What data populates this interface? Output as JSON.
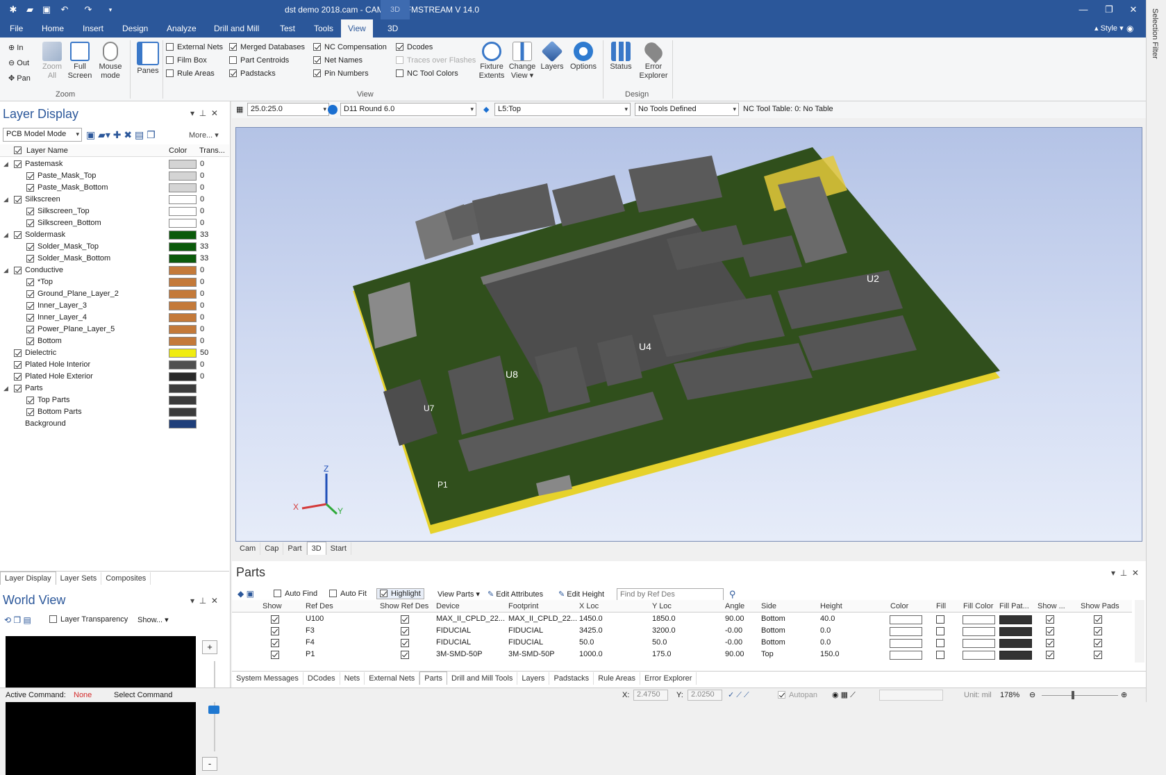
{
  "title_bar": {
    "title": "dst demo 2018.cam - CAM350/DFMSTREAM V 14.0",
    "context_tab": "3D"
  },
  "menu": {
    "items": [
      "File",
      "Home",
      "Insert",
      "Design",
      "Analyze",
      "Drill and Mill",
      "Test",
      "Tools",
      "View",
      "3D"
    ],
    "active": "View",
    "style_label": "Style"
  },
  "ribbon": {
    "zoom": {
      "in": "In",
      "out": "Out",
      "pan": "Pan",
      "zoom_all": "Zoom All",
      "full_screen": "Full Screen",
      "mouse_mode": "Mouse mode",
      "label": "Zoom"
    },
    "panes": "Panes",
    "view_checks": [
      {
        "label": "External Nets",
        "checked": false,
        "disabled": false
      },
      {
        "label": "Film Box",
        "checked": false,
        "disabled": false
      },
      {
        "label": "Rule Areas",
        "checked": false,
        "disabled": false
      },
      {
        "label": "Merged Databases",
        "checked": true,
        "disabled": false
      },
      {
        "label": "Part Centroids",
        "checked": false,
        "disabled": false
      },
      {
        "label": "Padstacks",
        "checked": true,
        "disabled": false
      },
      {
        "label": "NC Compensation",
        "checked": true,
        "disabled": false
      },
      {
        "label": "Net Names",
        "checked": true,
        "disabled": false
      },
      {
        "label": "Pin Numbers",
        "checked": true,
        "disabled": false
      },
      {
        "label": "Dcodes",
        "checked": true,
        "disabled": false
      },
      {
        "label": "Traces over Flashes",
        "checked": false,
        "disabled": true
      },
      {
        "label": "NC Tool Colors",
        "checked": false,
        "disabled": false
      }
    ],
    "fixture_extents": "Fixture Extents",
    "change_view": "Change View",
    "layers": "Layers",
    "options": "Options",
    "view_label": "View",
    "status": "Status",
    "error_explorer": "Error Explorer",
    "design_label": "Design"
  },
  "layer_display": {
    "title": "Layer Display",
    "mode": "PCB Model Mode",
    "more": "More...",
    "col_name": "Layer Name",
    "col_color": "Color",
    "col_trans": "Trans...",
    "rows": [
      {
        "name": "Pastemask",
        "level": 0,
        "color": "#d4d4d4",
        "trans": "0",
        "checkbox": true
      },
      {
        "name": "Paste_Mask_Top",
        "level": 1,
        "color": "#d4d4d4",
        "trans": "0",
        "checkbox": true
      },
      {
        "name": "Paste_Mask_Bottom",
        "level": 1,
        "color": "#d4d4d4",
        "trans": "0",
        "checkbox": true
      },
      {
        "name": "Silkscreen",
        "level": 0,
        "color": "#ffffff",
        "trans": "0",
        "checkbox": true
      },
      {
        "name": "Silkscreen_Top",
        "level": 1,
        "color": "#ffffff",
        "trans": "0",
        "checkbox": true
      },
      {
        "name": "Silkscreen_Bottom",
        "level": 1,
        "color": "#ffffff",
        "trans": "0",
        "checkbox": true
      },
      {
        "name": "Soldermask",
        "level": 0,
        "color": "#0b5a0b",
        "trans": "33",
        "checkbox": true
      },
      {
        "name": "Solder_Mask_Top",
        "level": 1,
        "color": "#0b5a0b",
        "trans": "33",
        "checkbox": true
      },
      {
        "name": "Solder_Mask_Bottom",
        "level": 1,
        "color": "#0b5a0b",
        "trans": "33",
        "checkbox": true
      },
      {
        "name": "Conductive",
        "level": 0,
        "color": "#c47a3a",
        "trans": "0",
        "checkbox": true
      },
      {
        "name": "*Top",
        "level": 1,
        "color": "#c47a3a",
        "trans": "0",
        "checkbox": true
      },
      {
        "name": "Ground_Plane_Layer_2",
        "level": 1,
        "color": "#c47a3a",
        "trans": "0",
        "checkbox": true
      },
      {
        "name": "Inner_Layer_3",
        "level": 1,
        "color": "#c47a3a",
        "trans": "0",
        "checkbox": true
      },
      {
        "name": "Inner_Layer_4",
        "level": 1,
        "color": "#c47a3a",
        "trans": "0",
        "checkbox": true
      },
      {
        "name": "Power_Plane_Layer_5",
        "level": 1,
        "color": "#c47a3a",
        "trans": "0",
        "checkbox": true
      },
      {
        "name": "Bottom",
        "level": 1,
        "color": "#c47a3a",
        "trans": "0",
        "checkbox": true
      },
      {
        "name": "Dielectric",
        "level": 0,
        "color": "#f0ec10",
        "trans": "50",
        "checkbox": true
      },
      {
        "name": "Plated Hole Interior",
        "level": 0,
        "color": "#505050",
        "trans": "0",
        "checkbox": true
      },
      {
        "name": "Plated Hole Exterior",
        "level": 0,
        "color": "#2a2a2a",
        "trans": "0",
        "checkbox": true
      },
      {
        "name": "Parts",
        "level": 0,
        "color": "#3c3c3c",
        "trans": "",
        "checkbox": true
      },
      {
        "name": "Top Parts",
        "level": 1,
        "color": "#3c3c3c",
        "trans": "",
        "checkbox": true
      },
      {
        "name": "Bottom Parts",
        "level": 1,
        "color": "#3c3c3c",
        "trans": "",
        "checkbox": true
      },
      {
        "name": "Background",
        "level": 0,
        "color": "#1f3f7a",
        "trans": "",
        "checkbox": false
      }
    ],
    "tabs": [
      "Layer Display",
      "Layer Sets",
      "Composites"
    ]
  },
  "world_view": {
    "title": "World View",
    "layer_transparency": "Layer Transparency",
    "show": "Show...",
    "plus": "+",
    "minus": "-"
  },
  "viewbar": {
    "zoom_value": "25.0:25.0",
    "dcode": "D11   Round 6.0",
    "layer": "L5:Top",
    "tools": "No Tools Defined",
    "nc_table": "NC Tool Table: 0: No Table"
  },
  "viewport": {
    "axis": {
      "z": "Z",
      "x": "X",
      "y": "Y"
    },
    "ref_labels": [
      "U2",
      "U4",
      "U8",
      "U7",
      "P1"
    ]
  },
  "doc_tabs": {
    "items": [
      "Cam",
      "Cap",
      "Part",
      "3D",
      "Start"
    ],
    "active": "3D"
  },
  "parts": {
    "title": "Parts",
    "toolbar": {
      "auto_find": "Auto Find",
      "auto_fit": "Auto Fit",
      "highlight": "Highlight",
      "view_parts": "View Parts",
      "edit_attributes": "Edit Attributes",
      "edit_height": "Edit Height",
      "find_placeholder": "Find by Ref Des"
    },
    "columns": [
      "Show",
      "Ref Des",
      "Show Ref Des",
      "Device",
      "Footprint",
      "X Loc",
      "Y Loc",
      "Angle",
      "Side",
      "Height",
      "Color",
      "Fill",
      "Fill Color",
      "Fill Pat...",
      "Show ...",
      "Show Pads"
    ],
    "rows": [
      {
        "ref": "U100",
        "device": "MAX_II_CPLD_22...",
        "footprint": "MAX_II_CPLD_22...",
        "x": "1450.0",
        "y": "1850.0",
        "angle": "90.00",
        "side": "Bottom",
        "height": "40.0"
      },
      {
        "ref": "F3",
        "device": "FIDUCIAL",
        "footprint": "FIDUCIAL",
        "x": "3425.0",
        "y": "3200.0",
        "angle": "-0.00",
        "side": "Bottom",
        "height": "0.0"
      },
      {
        "ref": "F4",
        "device": "FIDUCIAL",
        "footprint": "FIDUCIAL",
        "x": "50.0",
        "y": "50.0",
        "angle": "-0.00",
        "side": "Bottom",
        "height": "0.0"
      },
      {
        "ref": "P1",
        "device": "3M-SMD-50P",
        "footprint": "3M-SMD-50P",
        "x": "1000.0",
        "y": "175.0",
        "angle": "90.00",
        "side": "Top",
        "height": "150.0"
      }
    ]
  },
  "bottom_tabs": {
    "items": [
      "System Messages",
      "DCodes",
      "Nets",
      "External Nets",
      "Parts",
      "Drill and Mill Tools",
      "Layers",
      "Padstacks",
      "Rule Areas",
      "Error Explorer"
    ],
    "active": "Parts"
  },
  "status": {
    "active_command_label": "Active Command:",
    "active_command": "None",
    "select_command": "Select Command",
    "x_label": "X:",
    "x_value": "2.4750",
    "y_label": "Y:",
    "y_value": "2.0250",
    "autopan": "Autopan",
    "unit": "Unit: mil",
    "zoom": "178%"
  },
  "right_strip": {
    "label": "Selection Filter"
  }
}
